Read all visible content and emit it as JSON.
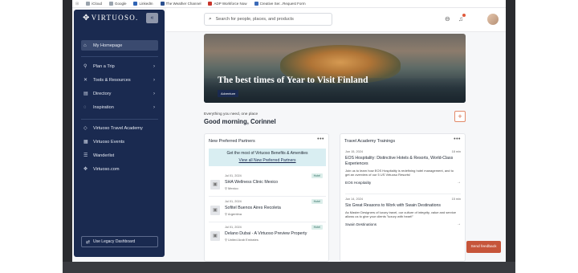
{
  "bookmarks": [
    {
      "label": "iCloud",
      "color": "#9aa3ad"
    },
    {
      "label": "Google",
      "color": "#9aa3ad"
    },
    {
      "label": "LinkedIn",
      "color": "#2f64b5"
    },
    {
      "label": "The Weather Channel",
      "color": "#2a4f8f"
    },
    {
      "label": "ADP Workforce Now",
      "color": "#c8352b"
    },
    {
      "label": "Creative Ser...Request Form",
      "color": "#3b6bb8"
    }
  ],
  "brand": {
    "name": "VIRTUOSO.",
    "color": "#1a2a50",
    "accent": "#c6553a"
  },
  "sidebar": {
    "collapse_icon": "double-chevron-left-icon",
    "items": [
      {
        "label": "My Homepage",
        "icon": "home-icon",
        "active": true
      },
      {
        "label": "Plan a Trip",
        "icon": "pin-icon",
        "chevron": true
      },
      {
        "label": "Tools & Resources",
        "icon": "tools-icon",
        "chevron": true
      },
      {
        "label": "Directory",
        "icon": "book-icon",
        "chevron": true
      },
      {
        "label": "Inspiration",
        "icon": "lightbulb-icon",
        "chevron": true
      },
      {
        "label": "Virtuoso Travel Academy",
        "icon": "academy-icon"
      },
      {
        "label": "Virtuoso Events",
        "icon": "calendar-icon"
      },
      {
        "label": "Wanderlist",
        "icon": "list-icon"
      },
      {
        "label": "Virtuoso.com",
        "icon": "globe-icon"
      }
    ],
    "legacy_label": "Use Legacy Dashboard"
  },
  "topbar": {
    "search_placeholder": "Search for people, places, and products"
  },
  "hero": {
    "title": "The best times of Year to Visit Finland",
    "tag": "Adventure"
  },
  "greeting": {
    "subtitle": "Everything you need, one place",
    "title": "Good morning, Corinnel"
  },
  "partners": {
    "title": "New Preferred Partners",
    "promo_title": "Get the most of Virtuoso Benefits & Amenities",
    "promo_link": "View all New Preferred Partners",
    "items": [
      {
        "date": "Jul 01, 2024",
        "badge": "Hotel",
        "name": "SHA Wellness Clinic Mexico",
        "location": "Mexico"
      },
      {
        "date": "Jul 01, 2024",
        "badge": "Hotel",
        "name": "Sofitel Buenos Aires Recoleta",
        "location": "Argentina"
      },
      {
        "date": "Jul 01, 2024",
        "badge": "Hotel",
        "name": "Delano Dubai - A Virtuoso Preview Property",
        "location": "United Arab Emirates"
      }
    ]
  },
  "trainings": {
    "title": "Travel Academy Trainings",
    "items": [
      {
        "date": "Jun 15, 2024",
        "duration": "18 min",
        "title": "EOS Hospitality: Distinctive Hotels & Resorts, World-Class Experiences",
        "desc": "Join us to learn how EOS Hospitality is redefining hotel management, and to get an overview of our 5 US Virtuoso Resorts!",
        "link": "EOS Hospitality"
      },
      {
        "date": "Jun 14, 2024",
        "duration": "15 min",
        "title": "Six Great Reasons to Work with Swain Destinations",
        "desc": "As Master Designers of luxury travel, our culture of integrity, value and service allows us to give your clients \"luxury with heart!\"",
        "link": "Swain Destinations"
      }
    ]
  },
  "feedback_label": "Send feedback"
}
